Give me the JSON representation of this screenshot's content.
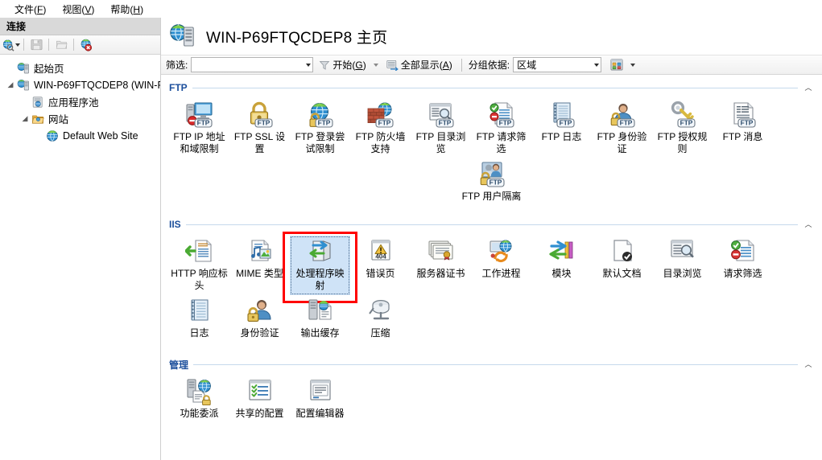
{
  "window": {
    "menu": [
      {
        "label": "文件",
        "mnemonic": "F"
      },
      {
        "label": "视图",
        "mnemonic": "V"
      },
      {
        "label": "帮助",
        "mnemonic": "H"
      }
    ]
  },
  "sidebar": {
    "title": "连接",
    "toolbar": [
      {
        "name": "connect-to-icon",
        "label": ""
      },
      {
        "name": "save-icon",
        "label": ""
      },
      {
        "name": "open-folder-icon",
        "label": ""
      },
      {
        "name": "disconnect-icon",
        "label": ""
      }
    ],
    "tree": [
      {
        "label": "起始页",
        "level": 1,
        "expander": "",
        "icon": "start-page-icon"
      },
      {
        "label": "WIN-P69FTQCDEP8 (WIN-P",
        "level": 1,
        "expander": "▲",
        "icon": "server-icon"
      },
      {
        "label": "应用程序池",
        "level": 2,
        "expander": "",
        "icon": "app-pools-icon"
      },
      {
        "label": "网站",
        "level": 2,
        "expander": "▲",
        "icon": "sites-folder-icon"
      },
      {
        "label": "Default Web Site",
        "level": 3,
        "expander": "",
        "icon": "web-site-icon"
      }
    ]
  },
  "content": {
    "title": "WIN-P69FTQCDEP8 主页",
    "filterbar": {
      "filter_label": "筛选:",
      "filter_value": "",
      "filter_placeholder": "",
      "start_label": "开始",
      "start_mnemonic": "G",
      "show_all_label": "全部显示",
      "show_all_mnemonic": "A",
      "group_by_label": "分组依据:",
      "group_by_value": "区域",
      "view_mode_label": ""
    },
    "groups": [
      {
        "name": "FTP",
        "collapse_glyph": "︿",
        "tiles": [
          {
            "label": "FTP IP 地址和域限制",
            "icon": "ftp-ip-restrictions-icon"
          },
          {
            "label": "FTP SSL 设置",
            "icon": "ftp-ssl-settings-icon"
          },
          {
            "label": "FTP 登录尝试限制",
            "icon": "ftp-logon-attempt-icon"
          },
          {
            "label": "FTP 防火墙支持",
            "icon": "ftp-firewall-icon"
          },
          {
            "label": "FTP 目录浏览",
            "icon": "ftp-directory-browsing-icon"
          },
          {
            "label": "FTP 请求筛选",
            "icon": "ftp-request-filtering-icon"
          },
          {
            "label": "FTP 日志",
            "icon": "ftp-logging-icon"
          },
          {
            "label": "FTP 身份验证",
            "icon": "ftp-authentication-icon"
          },
          {
            "label": "FTP 授权规则",
            "icon": "ftp-authorization-rules-icon"
          },
          {
            "label": "FTP 消息",
            "icon": "ftp-messages-icon"
          },
          {
            "label": "FTP 用户隔离",
            "icon": "ftp-user-isolation-icon"
          }
        ]
      },
      {
        "name": "IIS",
        "collapse_glyph": "︿",
        "tiles": [
          {
            "label": "HTTP 响应标头",
            "icon": "http-response-headers-icon"
          },
          {
            "label": "MIME 类型",
            "icon": "mime-types-icon"
          },
          {
            "label": "处理程序映射",
            "icon": "handler-mappings-icon",
            "selected": true,
            "highlighted": true
          },
          {
            "label": "错误页",
            "icon": "error-pages-icon"
          },
          {
            "label": "服务器证书",
            "icon": "server-certificates-icon"
          },
          {
            "label": "工作进程",
            "icon": "worker-processes-icon"
          },
          {
            "label": "模块",
            "icon": "modules-icon"
          },
          {
            "label": "默认文档",
            "icon": "default-document-icon"
          },
          {
            "label": "目录浏览",
            "icon": "directory-browsing-icon"
          },
          {
            "label": "请求筛选",
            "icon": "request-filtering-icon"
          },
          {
            "label": "日志",
            "icon": "logging-icon"
          },
          {
            "label": "身份验证",
            "icon": "authentication-icon"
          },
          {
            "label": "输出缓存",
            "icon": "output-caching-icon"
          },
          {
            "label": "压缩",
            "icon": "compression-icon"
          }
        ]
      },
      {
        "name": "管理",
        "collapse_glyph": "︿",
        "tiles": [
          {
            "label": "功能委派",
            "icon": "feature-delegation-icon"
          },
          {
            "label": "共享的配置",
            "icon": "shared-configuration-icon"
          },
          {
            "label": "配置编辑器",
            "icon": "configuration-editor-icon"
          }
        ]
      }
    ]
  },
  "colors": {
    "group_header": "#1c4f9c",
    "selection": "#cfe3f7",
    "highlight_box": "#ff0000",
    "pane_title_bg": "#d9d9d9"
  }
}
